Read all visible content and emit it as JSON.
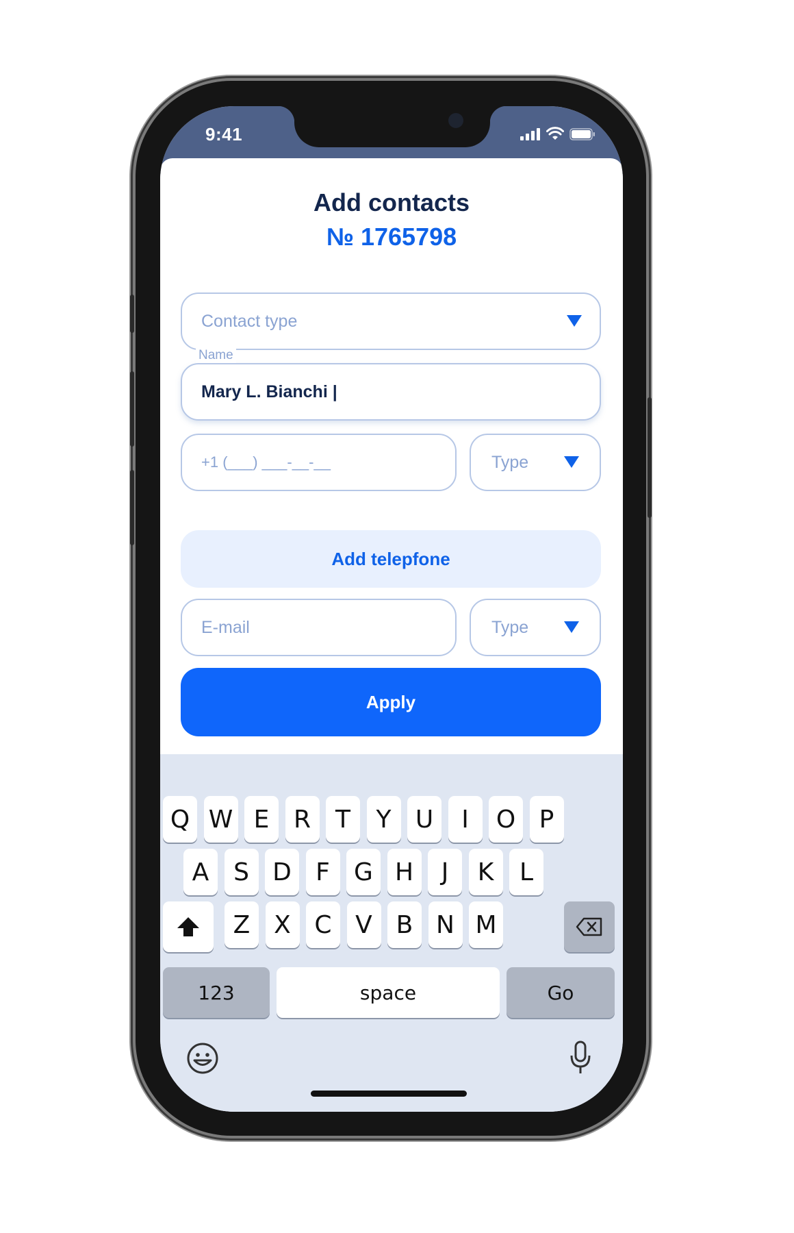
{
  "status_bar": {
    "time": "9:41"
  },
  "form": {
    "title": "Add contacts",
    "number": "№ 1765798",
    "contact_type_placeholder": "Contact type",
    "name_label": "Name",
    "name_value": "Mary L. Bianchi |",
    "phone_placeholder": "+1 (___) ___-__-__",
    "phone_type_placeholder": "Type",
    "add_phone_label": "Add telepfone",
    "email_placeholder": "E-mail",
    "email_type_placeholder": "Type",
    "apply_label": "Apply"
  },
  "keyboard": {
    "row1": [
      "Q",
      "W",
      "E",
      "R",
      "T",
      "Y",
      "U",
      "I",
      "O",
      "P"
    ],
    "row2": [
      "A",
      "S",
      "D",
      "F",
      "G",
      "H",
      "J",
      "K",
      "L"
    ],
    "row3": [
      "Z",
      "X",
      "C",
      "V",
      "B",
      "N",
      "M"
    ],
    "numbers_label": "123",
    "space_label": "space",
    "go_label": "Go"
  },
  "colors": {
    "accent": "#0f66fb",
    "title": "#13264d",
    "status_bar": "#4e6189",
    "keyboard_bg": "#dfe6f2"
  },
  "icons": [
    "signal-icon",
    "wifi-icon",
    "battery-icon",
    "dropdown-caret-icon",
    "shift-icon",
    "backspace-icon",
    "emoji-icon",
    "microphone-icon"
  ]
}
